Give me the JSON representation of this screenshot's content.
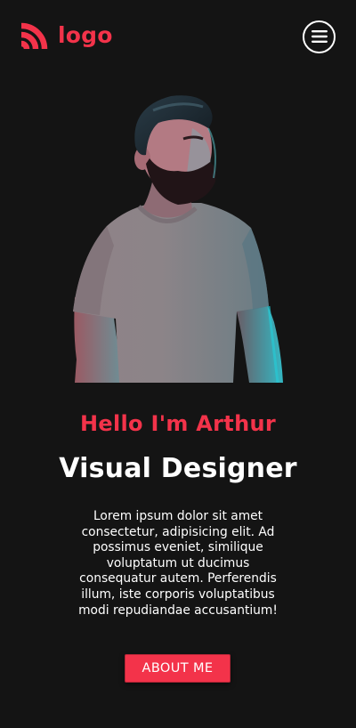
{
  "header": {
    "logo_text": "logo",
    "logo_icon": "rss-arcs-icon",
    "menu_icon": "hamburger-menu-icon"
  },
  "hero": {
    "image_alt": "Portrait of a bearded man in a grey t-shirt",
    "greeting": "Hello I'm Arthur",
    "title": "Visual Designer",
    "bio_lines": [
      "Lorem ipsum dolor sit amet",
      "consectetur, adipisicing elit. Ad",
      "possimus eveniet, similique",
      "voluptatum ut ducimus",
      "consequatur autem. Perferendis",
      "illum, iste corporis voluptatibus",
      "modi repudiandae accusantium!"
    ],
    "button_label": "ABOUT ME"
  },
  "colors": {
    "background": "#141414",
    "accent": "#f3334a",
    "text": "#ffffff"
  }
}
